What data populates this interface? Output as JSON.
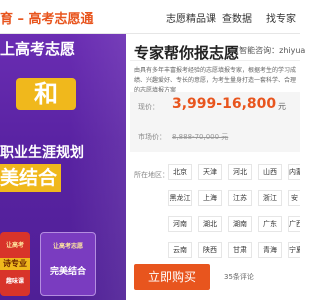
{
  "header": {
    "logo": "育 – 高考志愿通",
    "nav": [
      "志愿精品课",
      "查数据",
      "找专家"
    ]
  },
  "banner": {
    "line1": "上高考志愿",
    "he": "和",
    "line3": "职业生涯规划",
    "line4": "美结合",
    "card1": {
      "small": "让高考",
      "big": "诗专业",
      "tail": "趣味课"
    },
    "card2": {
      "small": "让高考志愿",
      "big": "完美结合"
    }
  },
  "product": {
    "title": "专家帮你报志愿",
    "consult": "(智能咨询：zhiyua",
    "description": "由具有多年丰富报考经验的志愿填报专家，根据考生的学习成绩、兴趣爱好、专长的意愿，为考生量身打造一套科学、合理的志愿填报方案",
    "price_label": "现价：",
    "price_value": "3,999-16,800",
    "price_unit": "元",
    "market_label": "市场价：",
    "market_value": "8,888-70,000 元"
  },
  "regions": {
    "label": "所在地区：",
    "items": [
      "北京",
      "天津",
      "河北",
      "山西",
      "内蒙",
      "黑龙江",
      "上海",
      "江苏",
      "浙江",
      "安",
      "河南",
      "湖北",
      "湖南",
      "广东",
      "广西",
      "云南",
      "陕西",
      "甘肃",
      "青海",
      "宁夏"
    ]
  },
  "actions": {
    "buy_label": "立即购买",
    "reviews": "35条评论"
  },
  "colors": {
    "accent": "#e8551e",
    "banner": "#5a23a3",
    "gold": "#f0b81c"
  }
}
